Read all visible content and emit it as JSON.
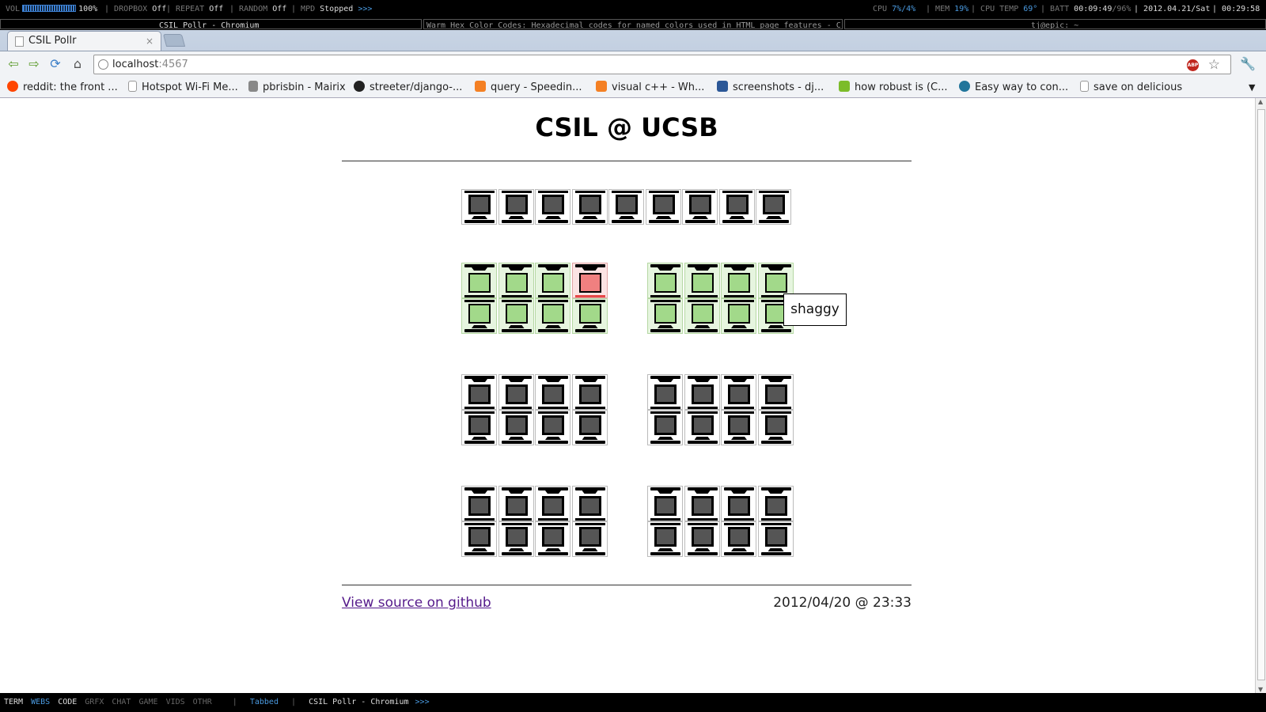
{
  "status_bar": {
    "vol_label": "VOL",
    "vol_pct": "100%",
    "vol_level": 1.0,
    "dropbox_label": "DROPBOX",
    "dropbox_val": "Off",
    "repeat_label": "REPEAT",
    "repeat_val": "Off",
    "random_label": "RANDOM",
    "random_val": "Off",
    "mpd_label": "MPD",
    "mpd_val": "Stopped",
    "mpd_arrows": ">>>",
    "cpu_label": "CPU",
    "cpu_val": "7%/4%",
    "mem_label": "MEM",
    "mem_val": "19%",
    "cputemp_label": "CPU TEMP",
    "cputemp_val": "69°",
    "batt_label": "BATT",
    "batt_time": "00:09:49",
    "batt_pct": "/96%",
    "date": "2012.04.21/Sat",
    "time": "00:29:58",
    "sep": "|"
  },
  "window_titles": {
    "active": "CSIL Pollr - Chromium",
    "inactive": "Warm Hex Color Codes: Hexadecimal codes for named colors used in HTML page features - C",
    "term": "tj@epic: ~"
  },
  "browser": {
    "tab_title": "CSIL Pollr",
    "tab_close": "×",
    "url_host": "localhost",
    "url_port": ":4567",
    "abp_label": "ABP",
    "bookmarks": [
      {
        "label": "reddit: the front ...",
        "icon": "reddit-icon",
        "color": "#ff4500"
      },
      {
        "label": "Hotspot Wi-Fi Me...",
        "icon": "page-icon",
        "color": "#dddddd"
      },
      {
        "label": "pbrisbin - Mairix",
        "icon": "pb-icon",
        "color": "#666666"
      },
      {
        "label": "streeter/django-...",
        "icon": "github-icon",
        "color": "#222222"
      },
      {
        "label": "query - Speedin...",
        "icon": "stackoverflow-icon",
        "color": "#f48024"
      },
      {
        "label": "visual c++ - Wh...",
        "icon": "stackoverflow-icon",
        "color": "#f48024"
      },
      {
        "label": "screenshots - dj...",
        "icon": "django-icon",
        "color": "#2b5797"
      },
      {
        "label": "how robust is (C...",
        "icon": "serverfault-icon",
        "color": "#7cbc2a"
      },
      {
        "label": "Easy way to con...",
        "icon": "wordpress-icon",
        "color": "#21759b"
      },
      {
        "label": "save on delicious",
        "icon": "page-icon",
        "color": "#dddddd"
      }
    ]
  },
  "page": {
    "title": "CSIL @ UCSB",
    "source_link": "View source on github",
    "timestamp": "2012/04/20 @ 23:33",
    "tooltip": "shaggy"
  },
  "lab": {
    "status_colors": {
      "offline": "#555555",
      "available": "#a2d98a",
      "in_use": "#f08080"
    },
    "front_row": [
      "offline",
      "offline",
      "offline",
      "offline",
      "offline",
      "offline",
      "offline",
      "offline",
      "offline"
    ],
    "clusters": [
      {
        "left": {
          "top": [
            "available",
            "available",
            "available",
            "in_use"
          ],
          "bottom": [
            "available",
            "available",
            "available",
            "available"
          ]
        },
        "right": {
          "top": [
            "available",
            "available",
            "available",
            "available"
          ],
          "bottom": [
            "available",
            "available",
            "available",
            "available"
          ]
        }
      },
      {
        "left": {
          "top": [
            "offline",
            "offline",
            "offline",
            "offline"
          ],
          "bottom": [
            "offline",
            "offline",
            "offline",
            "offline"
          ]
        },
        "right": {
          "top": [
            "offline",
            "offline",
            "offline",
            "offline"
          ],
          "bottom": [
            "offline",
            "offline",
            "offline",
            "offline"
          ]
        }
      },
      {
        "left": {
          "top": [
            "offline",
            "offline",
            "offline",
            "offline"
          ],
          "bottom": [
            "offline",
            "offline",
            "offline",
            "offline"
          ]
        },
        "right": {
          "top": [
            "offline",
            "offline",
            "offline",
            "offline"
          ],
          "bottom": [
            "offline",
            "offline",
            "offline",
            "offline"
          ]
        }
      }
    ]
  },
  "workspaces": {
    "items": [
      "TERM",
      "WEBS",
      "CODE",
      "GRFX",
      "CHAT",
      "GAME",
      "VIDS",
      "OTHR"
    ],
    "active": "WEBS",
    "occupied": [
      "TERM",
      "CODE"
    ],
    "layout": "Tabbed",
    "window": "CSIL Pollr - Chromium",
    "arrows": ">>>"
  }
}
